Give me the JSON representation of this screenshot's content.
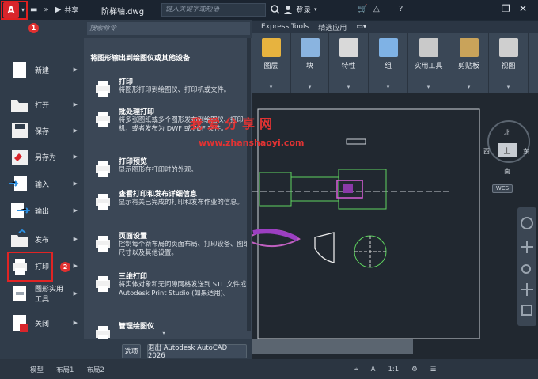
{
  "titlebar": {
    "app_letter": "A",
    "share_label": "共享",
    "file_name": "阶梯轴.dwg",
    "search_placeholder": "键入关键字或短语",
    "login_label": "登录"
  },
  "ribbon": {
    "tabs": [
      "Express Tools",
      "精选应用"
    ],
    "panels": [
      {
        "label": "图层",
        "color": "#e7b33f"
      },
      {
        "label": "块",
        "color": "#8ab4e0"
      },
      {
        "label": "特性",
        "color": "#d9d9d9"
      },
      {
        "label": "组",
        "color": "#7fb2e5"
      },
      {
        "label": "实用工具",
        "color": "#c9c9c9"
      },
      {
        "label": "剪贴板",
        "color": "#c9a35a"
      },
      {
        "label": "视图",
        "color": "#cfcfcf"
      }
    ]
  },
  "menu": {
    "search_placeholder": "搜索命令",
    "left_items": [
      {
        "label": "新建",
        "icon": "new-file-icon"
      },
      {
        "label": "打开",
        "icon": "open-folder-icon"
      },
      {
        "label": "保存",
        "icon": "save-icon"
      },
      {
        "label": "另存为",
        "icon": "save-as-icon"
      },
      {
        "label": "输入",
        "icon": "import-icon"
      },
      {
        "label": "输出",
        "icon": "export-icon"
      },
      {
        "label": "发布",
        "icon": "publish-icon"
      },
      {
        "label": "打印",
        "icon": "print-icon"
      },
      {
        "label": "图形实用\n工具",
        "icon": "drawing-utilities-icon"
      },
      {
        "label": "关闭",
        "icon": "close-file-icon"
      }
    ],
    "heading": "将图形输出到绘图仪或其他设备",
    "sub_items": [
      {
        "title": "打印",
        "desc": "将图形打印到绘图仪、打印机或文件。"
      },
      {
        "title": "批处理打印",
        "desc": "将多张图纸或多个图形发布到绘图仪、打印机，或者发布为 DWF 或 PDF 文件。"
      },
      {
        "title": "打印预览",
        "desc": "显示图形在打印时的外观。"
      },
      {
        "title": "查看打印和发布详细信息",
        "desc": "显示有关已完成的打印和发布作业的信息。"
      },
      {
        "title": "页面设置",
        "desc": "控制每个新布局的页面布局、打印设备、图纸尺寸以及其他设置。"
      },
      {
        "title": "三维打印",
        "desc": "将实体对象和无间隙网格发送到 STL 文件或 Autodesk Print Studio (如果适用)。"
      },
      {
        "title": "管理绘图仪",
        "desc": ""
      }
    ],
    "options_label": "选项",
    "exit_label": "退出 Autodesk AutoCAD 2026"
  },
  "viewcube": {
    "north": "北",
    "south": "南",
    "west": "西",
    "east": "东",
    "top": "上",
    "wcs": "WCS"
  },
  "status": {
    "tabs": [
      "模型",
      "布局1",
      "布局2"
    ],
    "scale": "1:1"
  },
  "watermark": {
    "cn": "我爱分享网",
    "url": "www.zhanshaoyi.com"
  },
  "annotations": {
    "badge1": "1",
    "badge2": "2"
  },
  "colors": {
    "accent_red": "#d9252b",
    "menu_bg": "#3b4756",
    "left_bg": "#303c4a"
  }
}
